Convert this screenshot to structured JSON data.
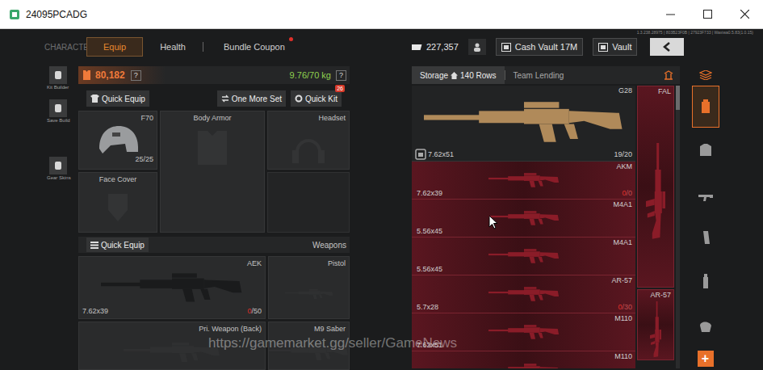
{
  "window": {
    "title": "24095PCADG"
  },
  "build_info": "1.3.238.28975 | 803B23F0B | 27923F733 | Waxiwa0.5.83(1.0.15)",
  "top_nav": {
    "section": "CHARACTER",
    "tabs": [
      {
        "label": "Equip",
        "selected": true,
        "notification": false
      },
      {
        "label": "Health",
        "selected": false,
        "notification": false
      },
      {
        "label": "Bundle Coupon",
        "selected": false,
        "notification": true
      }
    ]
  },
  "currency": {
    "cash": "227,357",
    "buttons": [
      "Cash Vault 17M",
      "Vault"
    ]
  },
  "side_tools": [
    "Kit Builder",
    "Save Build",
    "Gear Skins"
  ],
  "equip": {
    "value": "80,182",
    "value_help": "?",
    "weight": "9.76/70 kg",
    "weight_help": "?",
    "quick_equip": "Quick Equip",
    "one_more_set": "One More Set",
    "quick_kit": "Quick Kit",
    "quick_kit_badge": "26",
    "gear_slots": [
      {
        "label": "F70",
        "durability": "25/25",
        "filled": true
      },
      {
        "label": "Body Armor",
        "filled": false
      },
      {
        "label": "Headset",
        "filled": false
      },
      {
        "label": "Face Cover",
        "filled": false
      }
    ],
    "weapons_quick_equip": "Quick Equip",
    "weapons_label": "Weapons",
    "weapon_slots": [
      {
        "label": "AEK",
        "caliber": "7.62x39",
        "ammo_current": "0",
        "ammo_max": "/50",
        "filled": true,
        "empty": true
      },
      {
        "label": "Pistol",
        "filled": false
      },
      {
        "label": "Pri. Weapon (Back)",
        "filled": false
      },
      {
        "label": "M9 Saber",
        "filled": false
      }
    ]
  },
  "storage": {
    "tabs": [
      {
        "label": "Storage",
        "rows": "140 Rows",
        "selected": true
      },
      {
        "label": "Team Lending",
        "selected": false
      }
    ],
    "items": [
      {
        "name": "G28",
        "caliber": "7.62x51",
        "ammo_current": "19",
        "ammo_max": "/20",
        "unavailable": false,
        "empty": false
      },
      {
        "name": "AKM",
        "caliber": "7.62x39",
        "ammo_current": "0",
        "ammo_max": "/0",
        "unavailable": true,
        "empty": true
      },
      {
        "name": "M4A1",
        "caliber": "5.56x45",
        "unavailable": true,
        "empty": false
      },
      {
        "name": "M4A1",
        "caliber": "5.56x45",
        "unavailable": true,
        "empty": false
      },
      {
        "name": "AR-57",
        "caliber": "5.7x28",
        "ammo_current": "0",
        "ammo_max": "/30",
        "unavailable": true,
        "empty": true
      },
      {
        "name": "M110",
        "caliber": "7.62x51",
        "unavailable": true,
        "empty": false
      },
      {
        "name": "M110",
        "unavailable": true,
        "empty": false
      }
    ],
    "side_items": [
      {
        "name": "FAL",
        "unavailable": true
      },
      {
        "name": "AR-57",
        "unavailable": true
      }
    ]
  },
  "category_tabs": [
    {
      "selected": true
    },
    {
      "selected": false
    },
    {
      "selected": false
    },
    {
      "selected": false
    },
    {
      "selected": false
    },
    {
      "selected": false
    }
  ],
  "add_button": "+",
  "watermark": "https://gamemarket.gg/seller/GameNews"
}
